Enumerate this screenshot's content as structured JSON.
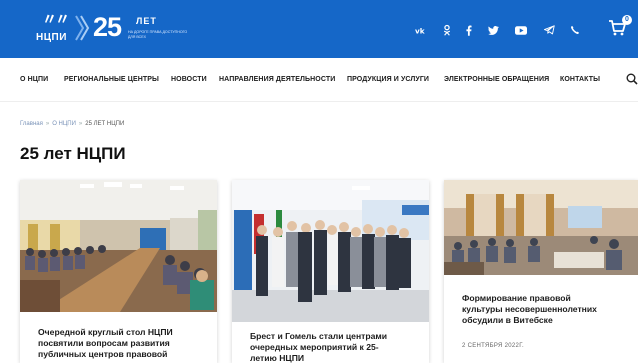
{
  "header": {
    "logo_text": "НЦПИ",
    "anniversary_number": "25",
    "anniversary_word": "ЛЕТ",
    "anniversary_subtitle": "НА ДОРОГЕ ПРАВА ДОСТУПНОГО ДЛЯ ВСЕХ",
    "social_icons": [
      "vk-icon",
      "odnoklassniki-icon",
      "facebook-icon",
      "twitter-icon",
      "youtube-icon",
      "telegram-icon",
      "viber-icon"
    ],
    "social_labels": [
      "vk",
      "ok",
      "f",
      "t",
      "yt",
      "tg",
      "vb"
    ],
    "cart_count": "0",
    "brand_color": "#1567c8"
  },
  "nav": {
    "items": [
      "О НЦПИ",
      "РЕГИОНАЛЬНЫЕ ЦЕНТРЫ",
      "НОВОСТИ",
      "НАПРАВЛЕНИЯ ДЕЯТЕЛЬНОСТИ",
      "ПРОДУКЦИЯ И УСЛУГИ",
      "ЭЛЕКТРОННЫЕ ОБРАЩЕНИЯ",
      "КОНТАКТЫ"
    ]
  },
  "breadcrumb": {
    "items": [
      "Главная",
      "О НЦПИ"
    ],
    "current": "25 ЛЕТ НЦПИ"
  },
  "page": {
    "title": "25 лет НЦПИ"
  },
  "cards": [
    {
      "title_lines": [
        "Очередной круглый стол НЦПИ",
        "посвятили вопросам развития",
        "публичных центров правовой"
      ],
      "date": ""
    },
    {
      "title_lines": [
        "Брест и Гомель стали центрами",
        "очередных мероприятий к 25-",
        "летию НЦПИ"
      ],
      "date": ""
    },
    {
      "title_lines": [
        "Формирование правовой",
        "культуры несовершеннолетних",
        "обсудили в Витебске"
      ],
      "date": "2 СЕНТЯБРЯ 2022Г."
    }
  ]
}
